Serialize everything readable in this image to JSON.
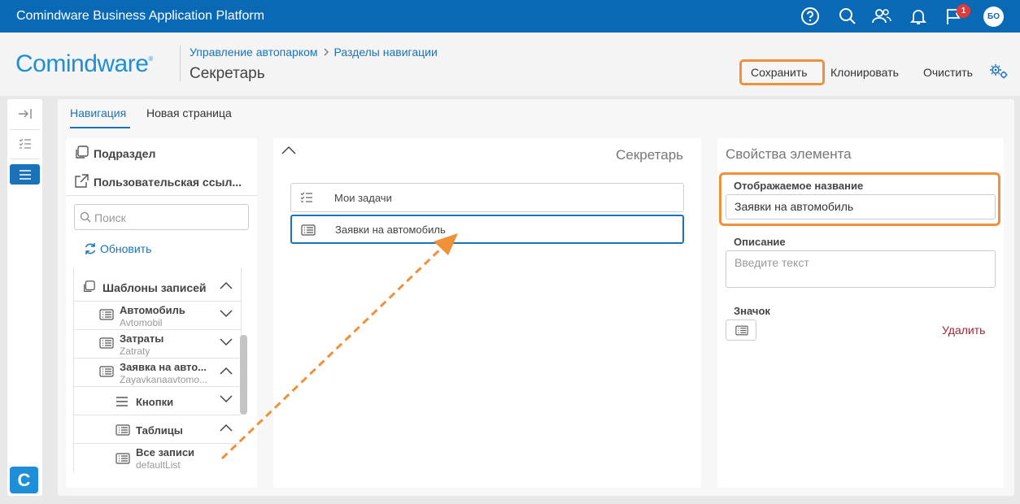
{
  "topbar": {
    "title": "Comindware Business Application Platform",
    "notification_count": "1",
    "avatar_initials": "БО",
    "icons": [
      "help-icon",
      "search-icon",
      "users-icon",
      "bell-icon",
      "flag-icon"
    ]
  },
  "header": {
    "logo_text": "Comindware",
    "logo_reg": "®",
    "breadcrumb": [
      "Управление автопарком",
      "Разделы навигации"
    ],
    "breadcrumb_separator": ">",
    "title": "Секретарь",
    "actions": {
      "save": "Сохранить",
      "clone": "Клонировать",
      "clear": "Очистить"
    }
  },
  "rail": {
    "logo_letter": "C"
  },
  "tabs": [
    {
      "label": "Навигация",
      "active": true
    },
    {
      "label": "Новая страница",
      "active": false
    }
  ],
  "left_panel": {
    "items": [
      "Подраздел",
      "Пользовательская ссыл..."
    ],
    "search_placeholder": "Поиск",
    "refresh_label": "Обновить",
    "tree": {
      "group": "Шаблоны записей",
      "nodes": [
        {
          "name": "Автомобиль",
          "sub": "Avtomobil"
        },
        {
          "name": "Затраты",
          "sub": "Zatraty"
        },
        {
          "name": "Заявка на авто...",
          "sub": "Zayavkanaavtomo..."
        },
        {
          "name": "Кнопки",
          "sub": ""
        },
        {
          "name": "Таблицы",
          "sub": ""
        },
        {
          "name": "Все записи",
          "sub": "defaultList"
        }
      ]
    }
  },
  "middle_panel": {
    "title": "Секретарь",
    "rows": [
      {
        "label": "Мои задачи",
        "icon": "tasks-icon",
        "selected": false
      },
      {
        "label": "Заявки на автомобиль",
        "icon": "list-icon",
        "selected": true
      }
    ]
  },
  "right_panel": {
    "title": "Свойства элемента",
    "display_name_label": "Отображаемое название",
    "display_name_value": "Заявки на автомобиль",
    "description_label": "Описание",
    "description_placeholder": "Введите текст",
    "icon_label": "Значок",
    "delete_label": "Удалить"
  },
  "colors": {
    "topbar": "#0a69b4",
    "accent": "#1a73b8",
    "highlight": "#f0913a",
    "delete": "#a0253a"
  }
}
